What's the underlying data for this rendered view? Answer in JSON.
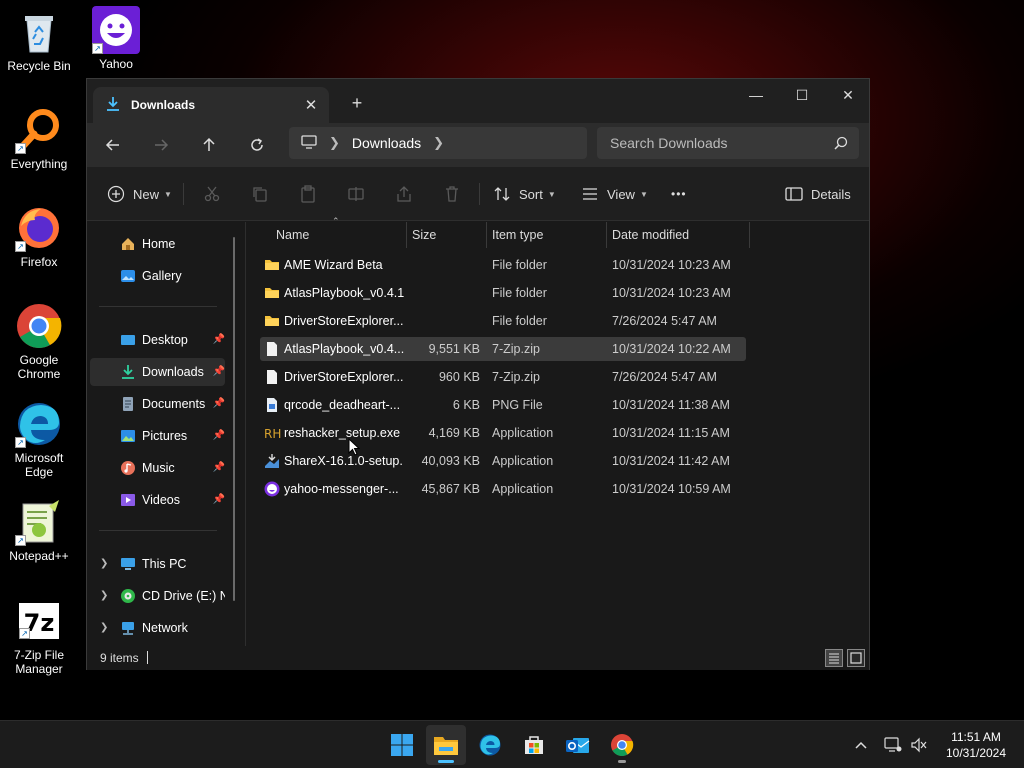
{
  "desktop": {
    "icons": [
      {
        "label": "Recycle Bin"
      },
      {
        "label": "Yahoo"
      },
      {
        "label": "Everything"
      },
      {
        "label": "Firefox"
      },
      {
        "label": "Google Chrome"
      },
      {
        "label": "Microsoft Edge"
      },
      {
        "label": "Notepad++"
      },
      {
        "label": "7-Zip File Manager"
      }
    ]
  },
  "window": {
    "tab_title": "Downloads",
    "tab_close": "✕",
    "new_tab": "+",
    "caption": {
      "minimize": "—",
      "maximize": "☐",
      "close": "✕"
    },
    "address": {
      "crumbs": [
        "Downloads"
      ],
      "search_placeholder": "Search Downloads"
    },
    "toolbar": {
      "new_label": "New",
      "sort_label": "Sort",
      "view_label": "View",
      "more_label": "•••",
      "details_label": "Details"
    },
    "sidebar": {
      "items": [
        {
          "label": "Home"
        },
        {
          "label": "Gallery"
        },
        {
          "label": "Desktop"
        },
        {
          "label": "Downloads"
        },
        {
          "label": "Documents"
        },
        {
          "label": "Pictures"
        },
        {
          "label": "Music"
        },
        {
          "label": "Videos"
        },
        {
          "label": "This PC"
        },
        {
          "label": "CD Drive (E:) NC"
        },
        {
          "label": "Network"
        }
      ]
    },
    "columns": {
      "name": "Name",
      "size": "Size",
      "type": "Item type",
      "date": "Date modified"
    },
    "files": [
      {
        "name": "AME Wizard Beta",
        "size": "",
        "type": "File folder",
        "date": "10/31/2024 10:23 AM"
      },
      {
        "name": "AtlasPlaybook_v0.4.1",
        "size": "",
        "type": "File folder",
        "date": "10/31/2024 10:23 AM"
      },
      {
        "name": "DriverStoreExplorer....",
        "size": "",
        "type": "File folder",
        "date": "7/26/2024 5:47 AM"
      },
      {
        "name": "AtlasPlaybook_v0.4....",
        "size": "9,551 KB",
        "type": "7-Zip.zip",
        "date": "10/31/2024 10:22 AM"
      },
      {
        "name": "DriverStoreExplorer....",
        "size": "960 KB",
        "type": "7-Zip.zip",
        "date": "7/26/2024 5:47 AM"
      },
      {
        "name": "qrcode_deadheart-...",
        "size": "6 KB",
        "type": "PNG File",
        "date": "10/31/2024 11:38 AM"
      },
      {
        "name": "reshacker_setup.exe",
        "size": "4,169 KB",
        "type": "Application",
        "date": "10/31/2024 11:15 AM"
      },
      {
        "name": "ShareX-16.1.0-setup...",
        "size": "40,093 KB",
        "type": "Application",
        "date": "10/31/2024 11:42 AM"
      },
      {
        "name": "yahoo-messenger-...",
        "size": "45,867 KB",
        "type": "Application",
        "date": "10/31/2024 10:59 AM"
      }
    ],
    "status": "9 items"
  },
  "taskbar": {
    "clock_time": "11:51 AM",
    "clock_date": "10/31/2024"
  },
  "colors": {
    "accent": "#4cc2ff",
    "folder": "#f4c23c",
    "window_bg": "#191919"
  }
}
